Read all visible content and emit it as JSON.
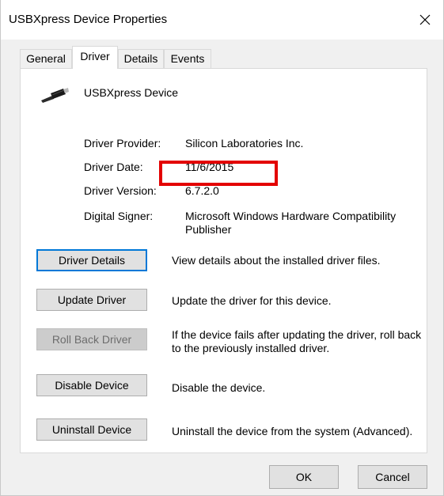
{
  "window": {
    "title": "USBXpress Device Properties",
    "close_glyph": "✕"
  },
  "tabs": [
    {
      "label": "General",
      "active": false
    },
    {
      "label": "Driver",
      "active": true
    },
    {
      "label": "Details",
      "active": false
    },
    {
      "label": "Events",
      "active": false
    }
  ],
  "device": {
    "icon": "usb-cable-icon",
    "name": "USBXpress Device"
  },
  "driver_info": {
    "provider_label": "Driver Provider:",
    "provider_value": "Silicon Laboratories Inc.",
    "date_label": "Driver Date:",
    "date_value": "11/6/2015",
    "version_label": "Driver Version:",
    "version_value": "6.7.2.0",
    "signer_label": "Digital Signer:",
    "signer_value": "Microsoft Windows Hardware Compatibility Publisher"
  },
  "actions": {
    "driver_details": {
      "label": "Driver Details",
      "description": "View details about the installed driver files."
    },
    "update_driver": {
      "label": "Update Driver",
      "description": "Update the driver for this device."
    },
    "roll_back_driver": {
      "label": "Roll Back Driver",
      "description": "If the device fails after updating the driver, roll back to the previously installed driver."
    },
    "disable_device": {
      "label": "Disable Device",
      "description": "Disable the device."
    },
    "uninstall_device": {
      "label": "Uninstall Device",
      "description": "Uninstall the device from the system (Advanced)."
    }
  },
  "footer": {
    "ok_label": "OK",
    "cancel_label": "Cancel"
  },
  "colors": {
    "annotation_red": "#e30000",
    "focus_blue": "#0078d7"
  }
}
